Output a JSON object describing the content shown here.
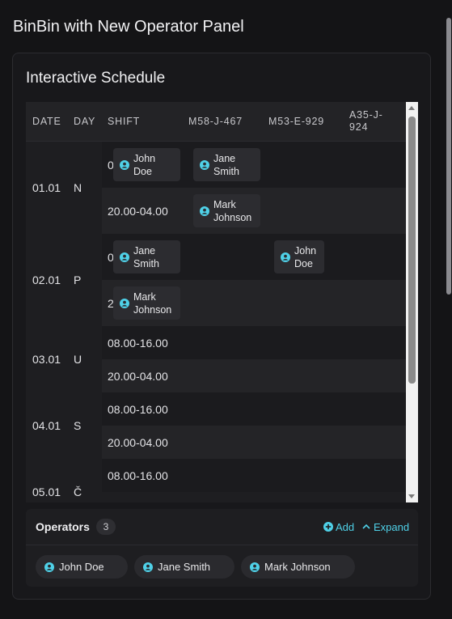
{
  "app_title": "BinBin with New Operator Panel",
  "schedule": {
    "title": "Interactive Schedule",
    "headers": [
      "DATE",
      "DAY",
      "SHIFT",
      "M58-J-467",
      "M53-E-929",
      "A35-J-\n924"
    ],
    "groups": [
      {
        "date": "01.01",
        "day": "N",
        "shifts": [
          {
            "time": "08.00-16.00",
            "cells": [
              "John\nDoe",
              "Jane\nSmith",
              ""
            ]
          },
          {
            "time": "20.00-04.00",
            "cells": [
              "",
              "Mark\nJohnson",
              ""
            ]
          }
        ]
      },
      {
        "date": "02.01",
        "day": "P",
        "shifts": [
          {
            "time": "08.00-16.00",
            "cells": [
              "Jane\nSmith",
              "",
              "John\nDoe"
            ]
          },
          {
            "time": "20.00-04.00",
            "cells": [
              "Mark\nJohnson",
              "",
              ""
            ]
          }
        ]
      },
      {
        "date": "03.01",
        "day": "U",
        "shifts": [
          {
            "time": "08.00-16.00",
            "cells": [
              "",
              "",
              ""
            ]
          },
          {
            "time": "20.00-04.00",
            "cells": [
              "",
              "",
              ""
            ]
          }
        ]
      },
      {
        "date": "04.01",
        "day": "S",
        "shifts": [
          {
            "time": "08.00-16.00",
            "cells": [
              "",
              "",
              ""
            ]
          },
          {
            "time": "20.00-04.00",
            "cells": [
              "",
              "",
              ""
            ]
          }
        ]
      },
      {
        "date": "05.01",
        "day": "Č",
        "shifts": [
          {
            "time": "08.00-16.00",
            "cells": [
              "",
              "",
              ""
            ]
          }
        ]
      }
    ]
  },
  "operators": {
    "title": "Operators",
    "count": "3",
    "add_label": "Add",
    "expand_label": "Expand",
    "list": [
      "John Doe",
      "Jane Smith",
      "Mark Johnson"
    ]
  },
  "colors": {
    "accent": "#4fd1e8",
    "background": "#141416",
    "card": "#1e1e21"
  },
  "icons": {
    "operator": "user-circle-icon",
    "add": "plus-circle-icon",
    "expand": "chevron-up-icon"
  }
}
